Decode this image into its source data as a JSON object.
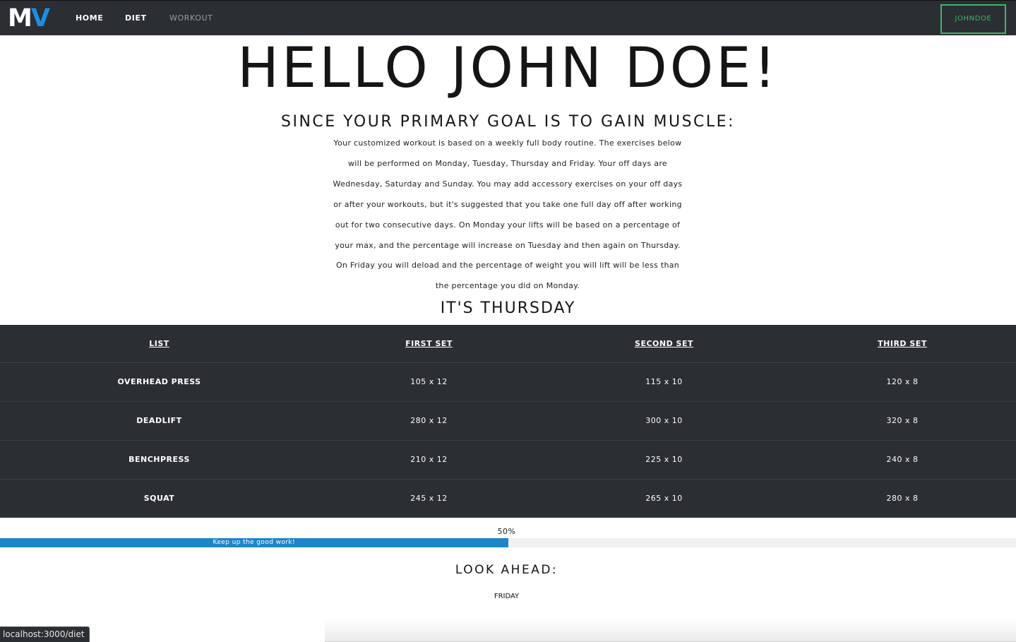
{
  "nav": {
    "logo_m": "M",
    "logo_v": "V",
    "links": [
      "HOME",
      "DIET",
      "WORKOUT"
    ],
    "user_button": "JOHNDOE"
  },
  "hero": {
    "greeting": "HELLO JOHN DOE!"
  },
  "goal": {
    "heading": "SINCE YOUR PRIMARY GOAL IS TO GAIN MUSCLE:",
    "description": "Your customized workout is based on a weekly full body routine. The exercises below will be performed on Monday, Tuesday, Thursday and Friday. Your off days are Wednesday, Saturday and Sunday. You may add accessory exercises on your off days or after your workouts, but it's suggested that you take one full day off after working out for two consecutive days. On Monday your lifts will be based on a percentage of your max, and the percentage will increase on Tuesday and then again on Thursday. On Friday you will deload and the percentage of weight you will lift will be less than the percentage you did on Monday."
  },
  "today": {
    "heading": "IT'S THURSDAY"
  },
  "table": {
    "headers": [
      "LIST",
      "FIRST SET",
      "SECOND SET",
      "THIRD SET"
    ],
    "rows": [
      [
        "OVERHEAD PRESS",
        "105 x 12",
        "115 x 10",
        "120 x 8"
      ],
      [
        "DEADLIFT",
        "280 x 12",
        "300 x 10",
        "320 x 8"
      ],
      [
        "BENCHPRESS",
        "210 x 12",
        "225 x 10",
        "240 x 8"
      ],
      [
        "SQUAT",
        "245 x 12",
        "265 x 10",
        "280 x 8"
      ]
    ]
  },
  "progress": {
    "label": "50%",
    "value": 0.5,
    "message": "Keep up the good work!",
    "color": "#1e86c8"
  },
  "look_ahead": {
    "heading": "LOOK AHEAD:",
    "next_day": "FRIDAY"
  },
  "status_bar": {
    "url": "localhost:3000/diet"
  },
  "colors": {
    "nav_bg": "#2b2e33",
    "logo_accent": "#1a8ee3",
    "user_button": "#3bb86a"
  }
}
